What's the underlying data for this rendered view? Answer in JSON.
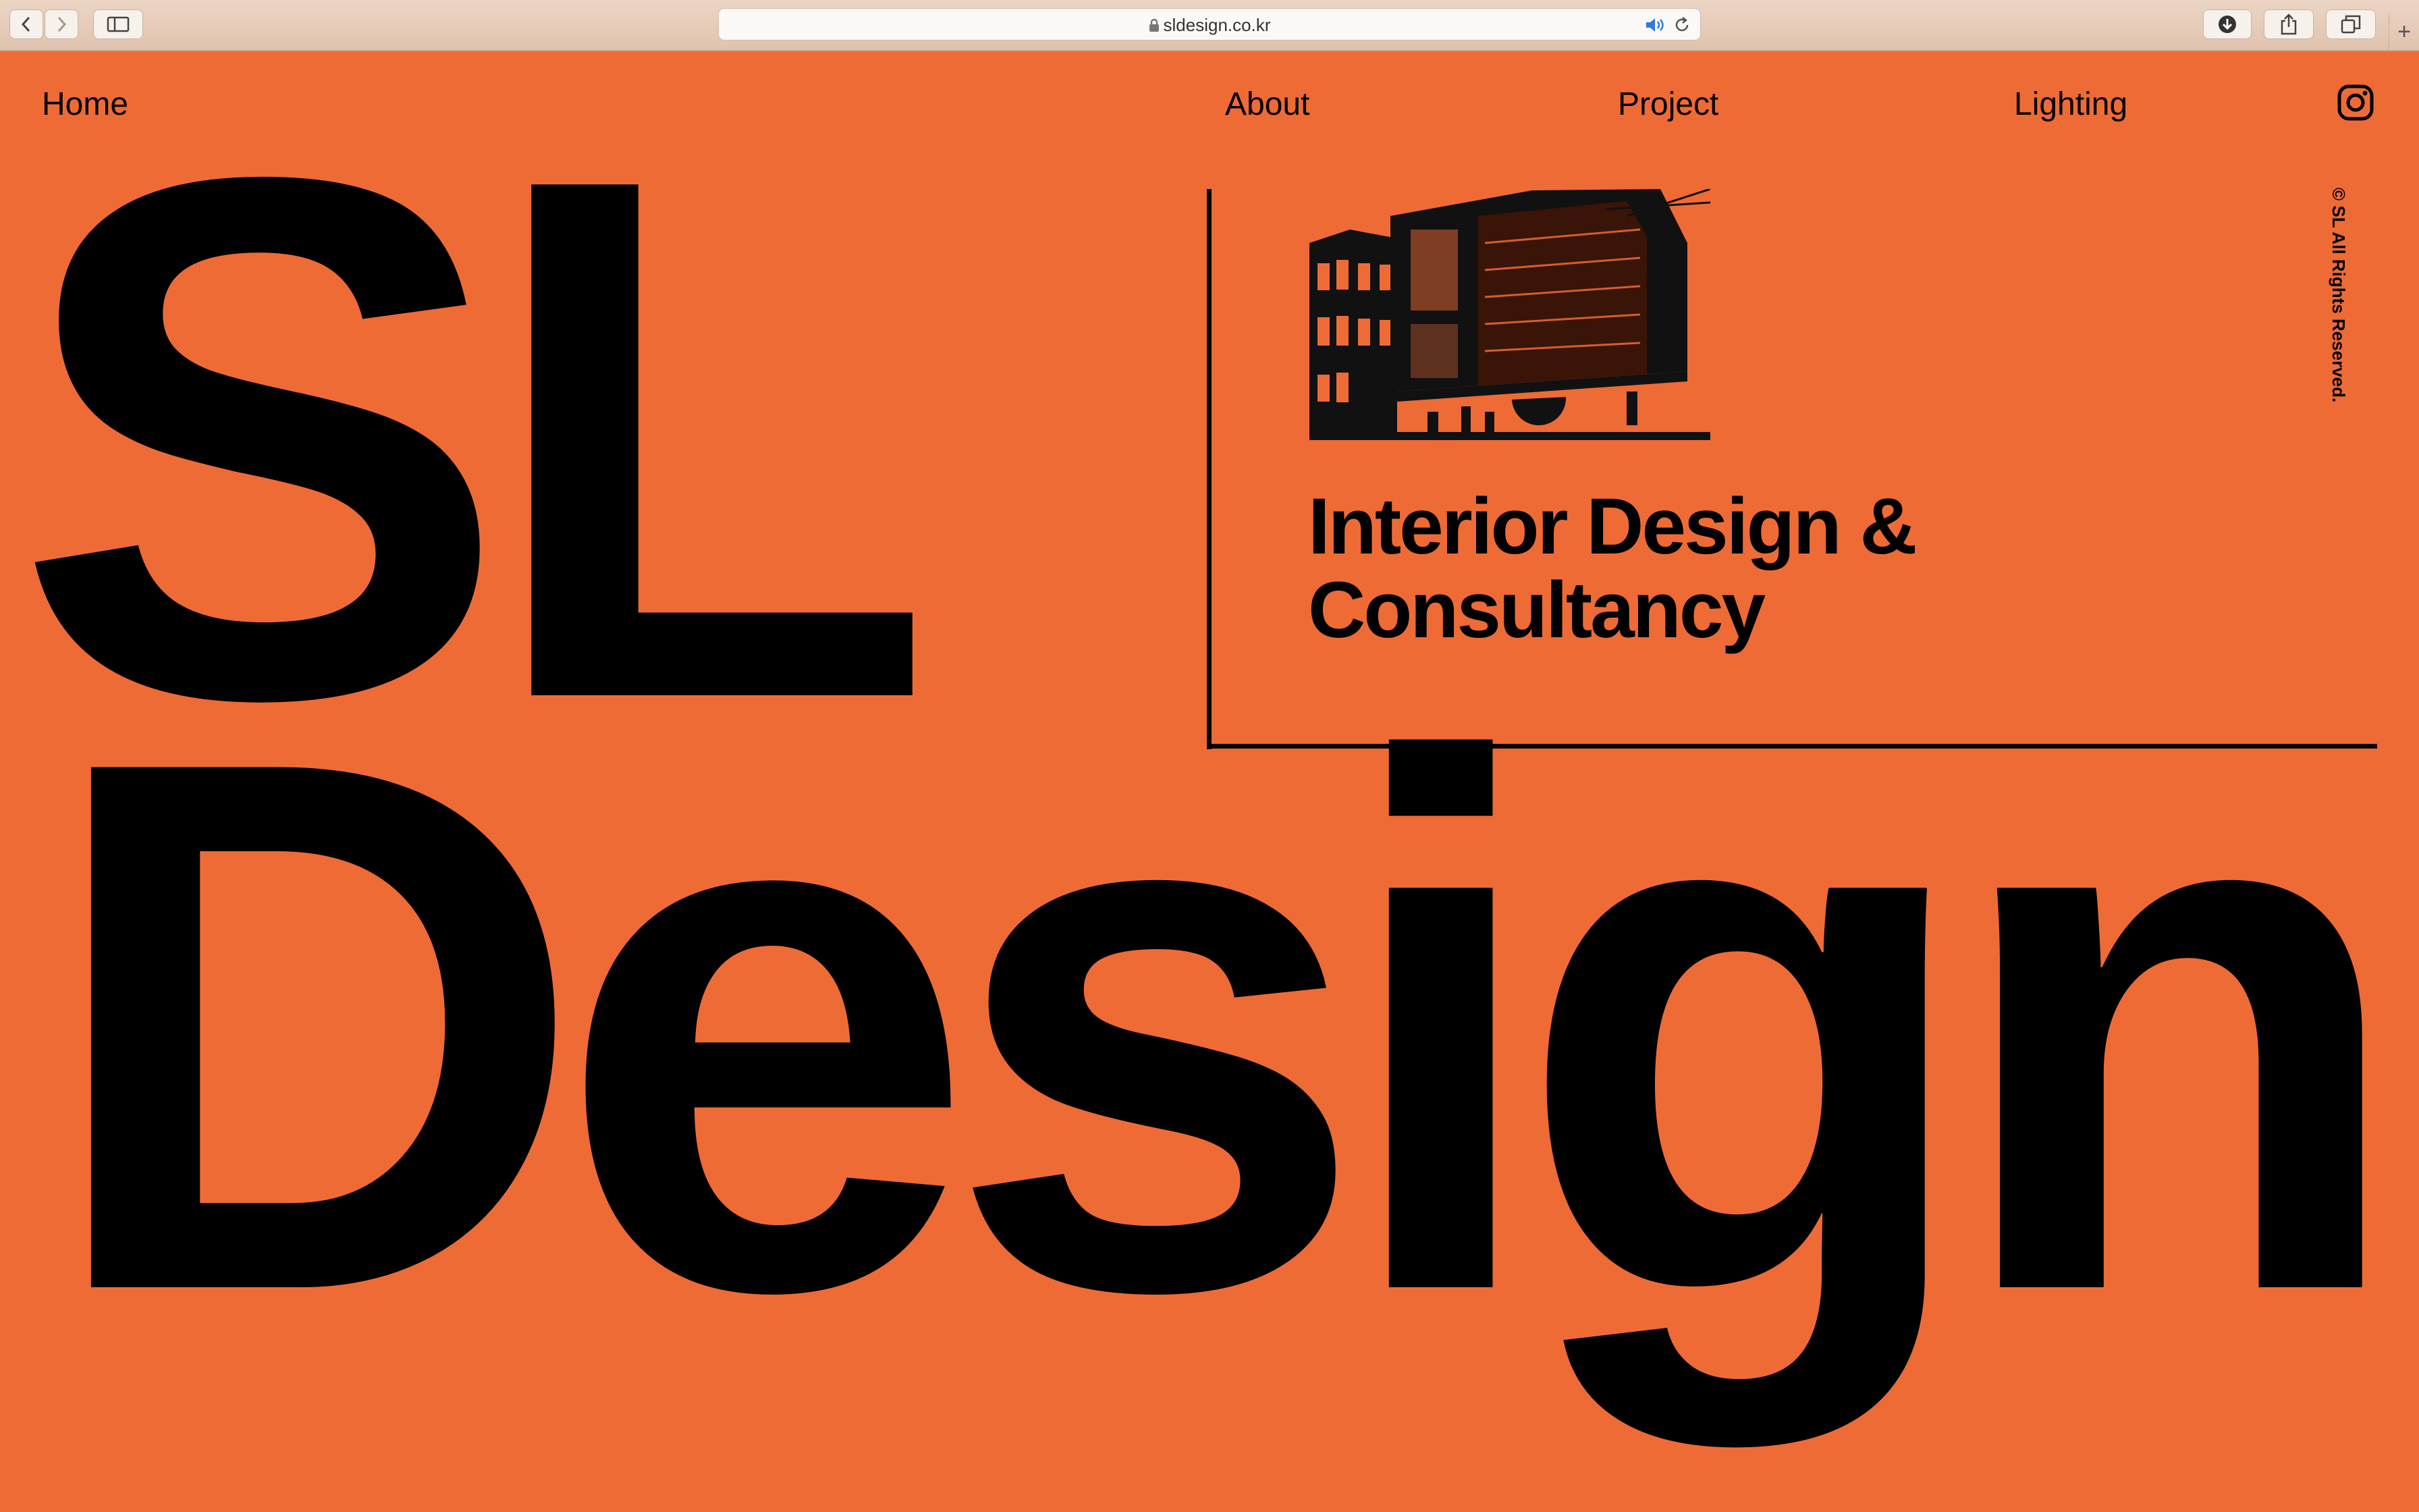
{
  "browser": {
    "url": "sldesign.co.kr",
    "new_tab_symbol": "+",
    "icons": [
      "chevron-left-icon",
      "chevron-right-icon",
      "sidebar-icon",
      "lock-icon",
      "speaker-icon",
      "reload-icon",
      "download-icon",
      "share-icon",
      "tabs-icon"
    ]
  },
  "nav": {
    "home": "Home",
    "about": "About",
    "project": "Project",
    "lighting": "Lighting",
    "social_icon": "instagram-icon"
  },
  "hero": {
    "line1": "SL",
    "line2": "Design",
    "tagline_line1": "Interior Design &",
    "tagline_line2": "Consultancy",
    "copyright": "© SL All Rights Reserved."
  },
  "colors": {
    "background": "#ee6b36",
    "text": "#000000",
    "chrome": "#e6ccb8"
  }
}
